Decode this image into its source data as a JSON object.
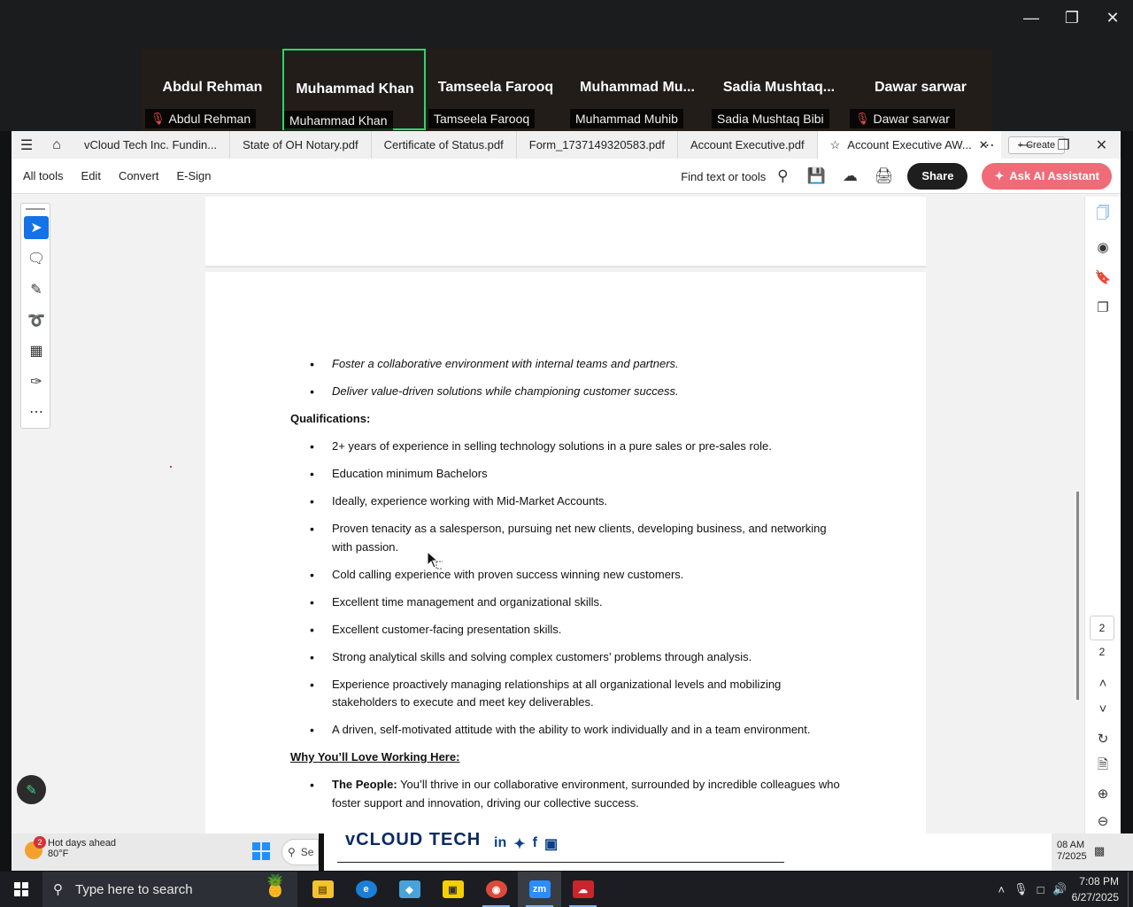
{
  "zoom": {
    "participants": [
      {
        "display": "Abdul Rehman",
        "label": "Abdul Rehman",
        "muted": true,
        "active": false
      },
      {
        "display": "Muhammad Khan",
        "label": "Muhammad Khan",
        "muted": false,
        "active": true
      },
      {
        "display": "Tamseela Farooq",
        "label": "Tamseela Farooq",
        "muted": false,
        "active": false
      },
      {
        "display": "Muhammad  Mu...",
        "label": "Muhammad Muhib",
        "muted": false,
        "active": false
      },
      {
        "display": "Sadia  Mushtaq...",
        "label": "Sadia Mushtaq Bibi",
        "muted": false,
        "active": false
      },
      {
        "display": "Dawar sarwar",
        "label": "Dawar sarwar",
        "muted": true,
        "active": false
      }
    ],
    "active_border_color": "#2bd66b"
  },
  "acrobat": {
    "tabs": [
      "vCloud Tech Inc. Fundin...",
      "State of OH Notary.pdf",
      "Certificate of Status.pdf",
      "Form_1737149320583.pdf",
      "Account Executive.pdf"
    ],
    "current_tab": "Account Executive AW...",
    "create_label": "Create",
    "menu": [
      "All tools",
      "Edit",
      "Convert",
      "E-Sign"
    ],
    "find_label": "Find text or tools",
    "share_label": "Share",
    "ai_label": "Ask AI Assistant",
    "page_current": "2",
    "page_total": "2",
    "accent_color": "#1473e6"
  },
  "document": {
    "responsibility_bullets": [
      "Foster a collaborative environment with internal teams and partners.",
      "Deliver value-driven solutions while championing customer success."
    ],
    "qualifications_heading": "Qualifications:",
    "qualifications": [
      "2+ years of experience in selling technology solutions in a pure sales or pre-sales role.",
      "Education  minimum Bachelors",
      "Ideally, experience working with Mid-Market Accounts.",
      "Proven tenacity as a salesperson, pursuing net new clients, developing business, and networking with passion.",
      "Cold calling experience with proven success winning new customers.",
      "Excellent time management and organizational skills.",
      "Excellent customer-facing presentation skills.",
      "Strong analytical skills and solving complex customers’ problems through analysis.",
      "Experience proactively managing relationships at all organizational levels and mobilizing stakeholders to execute and meet key deliverables.",
      "A driven, self-motivated attitude with the ability to work individually and in a team environment."
    ],
    "why_heading": "Why You’ll Love Working Here:",
    "people_label": "The People:",
    "people_text": " You’ll thrive in our collaborative environment, surrounded by incredible colleagues who foster support and innovation, driving our collective success."
  },
  "background": {
    "weather_badge": "2",
    "weather_title": "Hot days ahead",
    "weather_temp": "80°F",
    "search_stub": "Se",
    "doc_logo": "vCLOUD TECH",
    "time_stub": "08 AM",
    "date_stub": "7/2025"
  },
  "taskbar": {
    "search_placeholder": "Type here to search",
    "time": "7:08 PM",
    "date": "6/27/2025"
  }
}
